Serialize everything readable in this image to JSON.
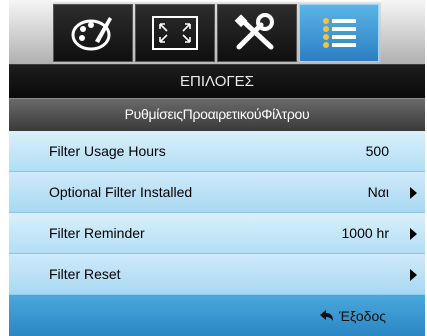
{
  "tabs": [
    {
      "icon": "palette-icon",
      "active": false
    },
    {
      "icon": "screen-resize-icon",
      "active": false
    },
    {
      "icon": "tools-icon",
      "active": false
    },
    {
      "icon": "options-list-icon",
      "active": true
    }
  ],
  "header": {
    "title": "ΕΠΙΛΟΓΕΣ",
    "subtitle": "ΡυθμίσειςΠροαιρετικούΦίλτρου"
  },
  "rows": [
    {
      "label": "Filter Usage Hours",
      "value": "500",
      "arrow": false
    },
    {
      "label": "Optional Filter Installed",
      "value": "Ναι",
      "arrow": true
    },
    {
      "label": "Filter Reminder",
      "value": "1000 hr",
      "arrow": true
    },
    {
      "label": "Filter Reset",
      "value": "",
      "arrow": true
    }
  ],
  "footer": {
    "exit_label": "Έξοδος",
    "exit_icon": "return-arrow-icon"
  },
  "colors": {
    "row_bg": "#c4e6f7",
    "footer_bg": "#3a97d0",
    "active_tab": "#3f9bd8"
  }
}
